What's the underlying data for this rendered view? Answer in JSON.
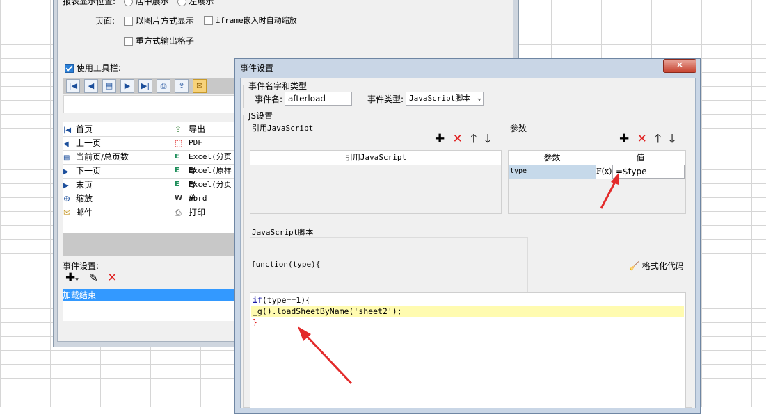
{
  "back_dialog": {
    "report_position_label": "报表显示位置:",
    "radio_center": "居中展示",
    "radio_left": "左展示",
    "page_label": "页面:",
    "cb_image_display": "以图片方式显示",
    "cb_iframe_zoom": "iframe嵌入时自动缩放",
    "cb_reexport": "重方式输出格子",
    "use_toolbar_label": "使用工具栏:",
    "items_left": [
      "首页",
      "上一页",
      "当前页/总页数",
      "下一页",
      "末页",
      "缩放",
      "邮件"
    ],
    "items_right": [
      "导出",
      "PDF",
      "Excel(分页导",
      "Excel(原样导",
      "Excel(分页分",
      "Word",
      "打印"
    ],
    "event_settings_label": "事件设置:",
    "event_item": "加载结束"
  },
  "dialog": {
    "title": "事件设置",
    "close_symbol": "✕",
    "event_group_title": "事件名字和类型",
    "event_name_label": "事件名:",
    "event_name_value": "afterload",
    "event_type_label": "事件类型:",
    "event_type_value": "JavaScript脚本",
    "js_group_title": "JS设置",
    "ref_js_title": "引用JavaScript",
    "ref_js_column": "引用JavaScript",
    "params_title": "参数",
    "params_col_param": "参数",
    "params_col_value": "值",
    "param_name": "type",
    "param_formula_icon": "F(x)",
    "param_value": "=$type",
    "script_title": "JavaScript脚本",
    "function_signature": "function(type){",
    "format_code_label": "格式化代码",
    "code_line1_kw": "if",
    "code_line1_rest": "(type==1){",
    "code_line2": "_g().loadSheetByName('sheet2');",
    "code_line3": "}"
  },
  "icons": {
    "add": "plus-icon",
    "delete": "x-icon",
    "up": "arrow-up-icon",
    "down": "arrow-down-icon",
    "broom": "broom-icon"
  },
  "colors": {
    "close_button": "#c7432f",
    "highlight_line": "#fffbb0",
    "selected_row": "#3399ff",
    "annotation_arrow": "#e32b2b"
  }
}
